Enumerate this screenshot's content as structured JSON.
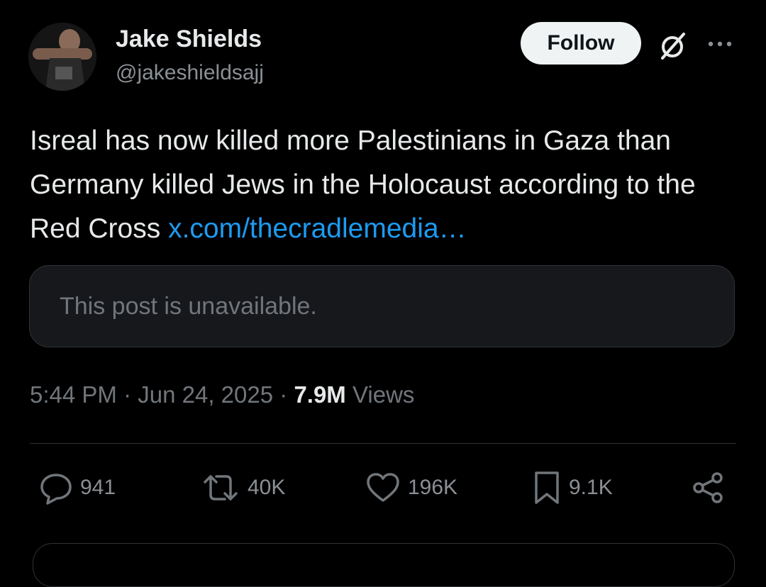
{
  "post": {
    "author_name": "Jake Shields",
    "author_handle": "@jakeshieldsajj",
    "follow_label": "Follow",
    "text_main": "Isreal has now killed more Palestinians in Gaza than Germany killed Jews in the Holocaust according to the Red Cross ",
    "link_text": "x.com/thecradlemedia…",
    "quote_unavailable": "This post is unavailable.",
    "time": "5:44 PM",
    "date": "Jun 24, 2025",
    "views_count": "7.9M",
    "views_label": "Views"
  },
  "actions": {
    "replies": "941",
    "reposts": "40K",
    "likes": "196K",
    "bookmarks": "9.1K"
  },
  "icons": [
    "grok-icon",
    "more-icon",
    "reply-icon",
    "repost-icon",
    "like-icon",
    "bookmark-icon",
    "share-icon"
  ],
  "colors": {
    "background": "#000000",
    "link": "#1d9bf0",
    "muted": "#71767b",
    "follow_bg": "#eff3f4"
  }
}
